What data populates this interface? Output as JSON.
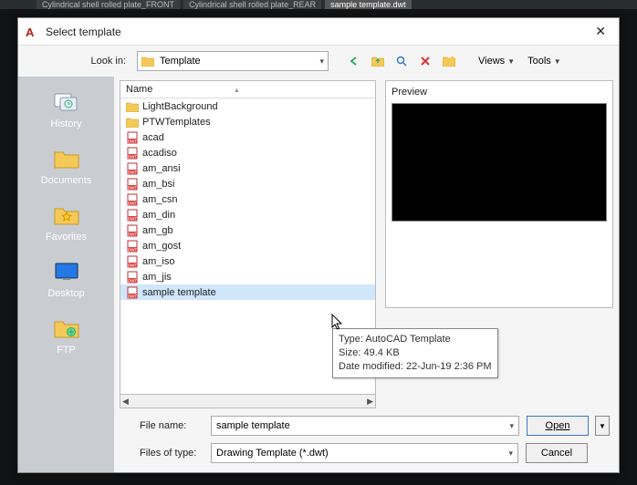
{
  "tabs": [
    {
      "label": "Cylindrical shell rolled plate_FRONT"
    },
    {
      "label": "Cylindrical shell rolled plate_REAR"
    },
    {
      "label": "sample template.dwt",
      "active": true
    }
  ],
  "dialog": {
    "title": "Select template",
    "lookin_label": "Look in:",
    "lookin_value": "Template",
    "views_label": "Views",
    "tools_label": "Tools",
    "name_header": "Name",
    "preview_label": "Preview",
    "filename_label": "File name:",
    "filename_value": "sample template",
    "filetype_label": "Files of type:",
    "filetype_value": "Drawing Template (*.dwt)",
    "open_label": "Open",
    "cancel_label": "Cancel"
  },
  "sidebar": [
    {
      "label": "History",
      "icon": "history"
    },
    {
      "label": "Documents",
      "icon": "folder"
    },
    {
      "label": "Favorites",
      "icon": "star"
    },
    {
      "label": "Desktop",
      "icon": "desktop"
    },
    {
      "label": "FTP",
      "icon": "ftp"
    }
  ],
  "files": [
    {
      "name": "LightBackground",
      "type": "folder"
    },
    {
      "name": "PTWTemplates",
      "type": "folder"
    },
    {
      "name": "acad",
      "type": "dwt"
    },
    {
      "name": "acadiso",
      "type": "dwt"
    },
    {
      "name": "am_ansi",
      "type": "dwt"
    },
    {
      "name": "am_bsi",
      "type": "dwt"
    },
    {
      "name": "am_csn",
      "type": "dwt"
    },
    {
      "name": "am_din",
      "type": "dwt"
    },
    {
      "name": "am_gb",
      "type": "dwt"
    },
    {
      "name": "am_gost",
      "type": "dwt"
    },
    {
      "name": "am_iso",
      "type": "dwt"
    },
    {
      "name": "am_jis",
      "type": "dwt"
    },
    {
      "name": "sample template",
      "type": "dwt",
      "selected": true
    }
  ],
  "tooltip": {
    "type_line": "Type: AutoCAD Template",
    "size_line": "Size: 49.4 KB",
    "date_line": "Date modified: 22-Jun-19 2:36 PM"
  },
  "toolbar_icons": [
    "back-icon",
    "up-folder-icon",
    "search-icon",
    "delete-icon",
    "new-folder-icon"
  ]
}
